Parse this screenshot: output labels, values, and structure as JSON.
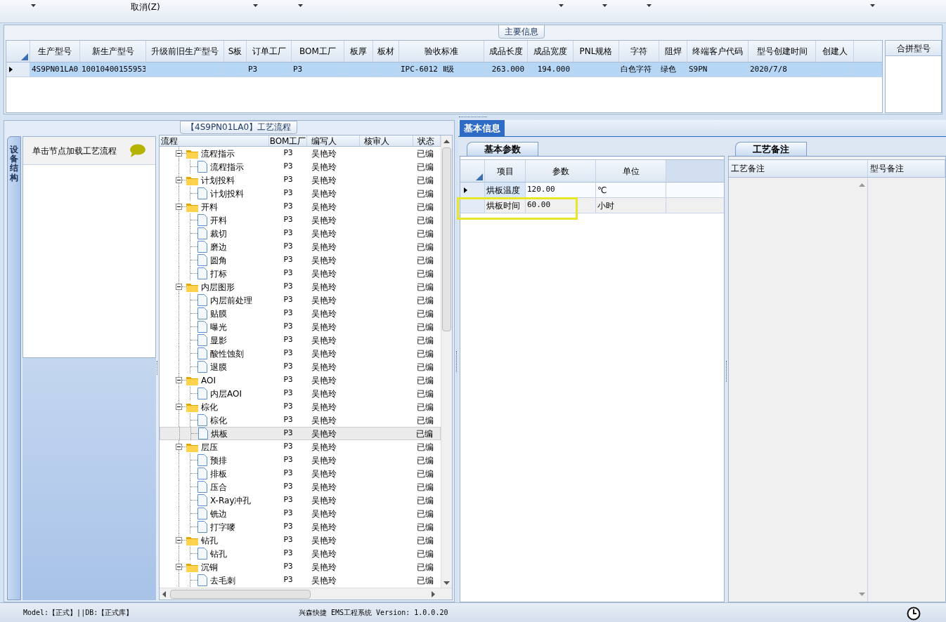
{
  "toolbar": {
    "cancel_label": "取消(Z)"
  },
  "main_info": {
    "title": "主要信息",
    "columns": [
      "生产型号",
      "新生产型号",
      "升级前旧生产型号",
      "S板",
      "订单工厂",
      "BOM工厂",
      "板厚",
      "板材",
      "验收标准",
      "成品长度",
      "成品宽度",
      "PNL规格",
      "字符",
      "阻焊",
      "终端客户代码",
      "型号创建时间",
      "创建人"
    ],
    "rows": [
      {
        "selected": true,
        "cells": [
          "4S9PN01LA0",
          "10010400155953",
          null,
          null,
          "P3",
          "P3",
          null,
          null,
          "IPC-6012 Ⅱ级",
          "263.000",
          "194.000",
          null,
          "白色字符",
          "绿色",
          "S9PN",
          "2020/7/8",
          null
        ]
      }
    ],
    "side_panel": {
      "title": "合拼型号"
    }
  },
  "process_panel": {
    "title": "【4S9PN01LA0】工艺流程",
    "side_tab": "设备结构",
    "hint": "单击节点加载工艺流程",
    "columns": [
      "流程",
      "BOM工厂",
      "编写人",
      "核审人",
      "状态"
    ],
    "tree": [
      {
        "label": "流程指示",
        "bom": "P3",
        "writer": "吴艳玲",
        "status": "已编",
        "expanded": true,
        "selected": false,
        "children": [
          {
            "label": "流程指示",
            "bom": "P3",
            "writer": "吴艳玲",
            "status": "已编",
            "selected": false
          }
        ]
      },
      {
        "label": "计划投料",
        "bom": "P3",
        "writer": "吴艳玲",
        "status": "已编",
        "expanded": true,
        "selected": false,
        "children": [
          {
            "label": "计划投料",
            "bom": "P3",
            "writer": "吴艳玲",
            "status": "已编",
            "selected": false
          }
        ]
      },
      {
        "label": "开料",
        "bom": "P3",
        "writer": "吴艳玲",
        "status": "已编",
        "expanded": true,
        "selected": false,
        "children": [
          {
            "label": "开料",
            "bom": "P3",
            "writer": "吴艳玲",
            "status": "已编",
            "selected": false
          },
          {
            "label": "裁切",
            "bom": "P3",
            "writer": "吴艳玲",
            "status": "已编",
            "selected": false
          },
          {
            "label": "磨边",
            "bom": "P3",
            "writer": "吴艳玲",
            "status": "已编",
            "selected": false
          },
          {
            "label": "圆角",
            "bom": "P3",
            "writer": "吴艳玲",
            "status": "已编",
            "selected": false
          },
          {
            "label": "打标",
            "bom": "P3",
            "writer": "吴艳玲",
            "status": "已编",
            "selected": false
          }
        ]
      },
      {
        "label": "内层图形",
        "bom": "P3",
        "writer": "吴艳玲",
        "status": "已编",
        "expanded": true,
        "selected": false,
        "children": [
          {
            "label": "内层前处理",
            "bom": "P3",
            "writer": "吴艳玲",
            "status": "已编",
            "selected": false
          },
          {
            "label": "贴膜",
            "bom": "P3",
            "writer": "吴艳玲",
            "status": "已编",
            "selected": false
          },
          {
            "label": "曝光",
            "bom": "P3",
            "writer": "吴艳玲",
            "status": "已编",
            "selected": false
          },
          {
            "label": "显影",
            "bom": "P3",
            "writer": "吴艳玲",
            "status": "已编",
            "selected": false
          },
          {
            "label": "酸性蚀刻",
            "bom": "P3",
            "writer": "吴艳玲",
            "status": "已编",
            "selected": false
          },
          {
            "label": "退膜",
            "bom": "P3",
            "writer": "吴艳玲",
            "status": "已编",
            "selected": false
          }
        ]
      },
      {
        "label": "AOI",
        "bom": "P3",
        "writer": "吴艳玲",
        "status": "已编",
        "expanded": true,
        "selected": false,
        "children": [
          {
            "label": "内层AOI",
            "bom": "P3",
            "writer": "吴艳玲",
            "status": "已编",
            "selected": false
          }
        ]
      },
      {
        "label": "棕化",
        "bom": "P3",
        "writer": "吴艳玲",
        "status": "已编",
        "expanded": true,
        "selected": false,
        "children": [
          {
            "label": "棕化",
            "bom": "P3",
            "writer": "吴艳玲",
            "status": "已编",
            "selected": false
          },
          {
            "label": "烘板",
            "bom": "P3",
            "writer": "吴艳玲",
            "status": "已编",
            "selected": true
          }
        ]
      },
      {
        "label": "层压",
        "bom": "P3",
        "writer": "吴艳玲",
        "status": "已编",
        "expanded": true,
        "selected": false,
        "children": [
          {
            "label": "预排",
            "bom": "P3",
            "writer": "吴艳玲",
            "status": "已编",
            "selected": false
          },
          {
            "label": "排板",
            "bom": "P3",
            "writer": "吴艳玲",
            "status": "已编",
            "selected": false
          },
          {
            "label": "压合",
            "bom": "P3",
            "writer": "吴艳玲",
            "status": "已编",
            "selected": false
          },
          {
            "label": "X-Ray冲孔",
            "bom": "P3",
            "writer": "吴艳玲",
            "status": "已编",
            "selected": false
          },
          {
            "label": "铣边",
            "bom": "P3",
            "writer": "吴艳玲",
            "status": "已编",
            "selected": false
          },
          {
            "label": "打字嘜",
            "bom": "P3",
            "writer": "吴艳玲",
            "status": "已编",
            "selected": false
          }
        ]
      },
      {
        "label": "钻孔",
        "bom": "P3",
        "writer": "吴艳玲",
        "status": "已编",
        "expanded": true,
        "selected": false,
        "children": [
          {
            "label": "钻孔",
            "bom": "P3",
            "writer": "吴艳玲",
            "status": "已编",
            "selected": false
          }
        ]
      },
      {
        "label": "沉铜",
        "bom": "P3",
        "writer": "吴艳玲",
        "status": "已编",
        "expanded": true,
        "selected": false,
        "children": [
          {
            "label": "去毛刺",
            "bom": "P3",
            "writer": "吴艳玲",
            "status": "已编",
            "selected": false
          }
        ]
      }
    ]
  },
  "info_panel": {
    "tabs": [
      {
        "label": "基本信息",
        "selected": true
      }
    ],
    "params": {
      "tab": "基本参数",
      "columns": [
        "项目",
        "参数",
        "单位"
      ],
      "rows": [
        {
          "item": "烘板温度",
          "value": "120.00",
          "unit": "℃",
          "current": true,
          "annotated": false
        },
        {
          "item": "烘板时间",
          "value": "60.00",
          "unit": "小时",
          "current": false,
          "annotated": true
        }
      ]
    },
    "notes": {
      "tab": "工艺备注",
      "columns": [
        "工艺备注",
        "型号备注"
      ]
    }
  },
  "status_bar": {
    "mode": "Model:【正式】||DB:【正式库】",
    "app": "兴森快捷 EMS工程系统 Version: 1.0.0.20"
  }
}
